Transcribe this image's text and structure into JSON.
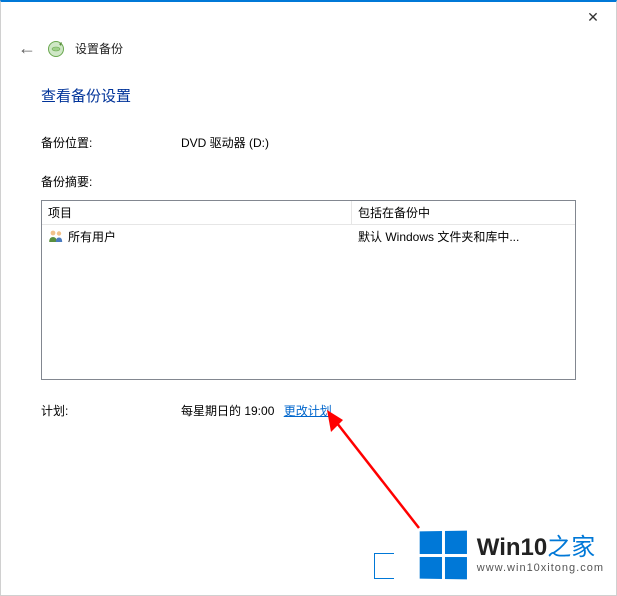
{
  "titlebar": {
    "close": "✕"
  },
  "header": {
    "back": "←",
    "title": "设置备份"
  },
  "page": {
    "title": "查看备份设置"
  },
  "location": {
    "label": "备份位置:",
    "value": "DVD 驱动器 (D:)"
  },
  "summary": {
    "label": "备份摘要:"
  },
  "table": {
    "col_item": "项目",
    "col_included": "包括在备份中",
    "rows": [
      {
        "icon": "users-icon",
        "item": "所有用户",
        "included": "默认 Windows 文件夹和库中..."
      }
    ]
  },
  "schedule": {
    "label": "计划:",
    "value": "每星期日的 19:00",
    "change_link": "更改计划"
  },
  "watermark": {
    "brand_a": "Win10",
    "brand_b": "之家",
    "url": "www.win10xitong.com"
  }
}
